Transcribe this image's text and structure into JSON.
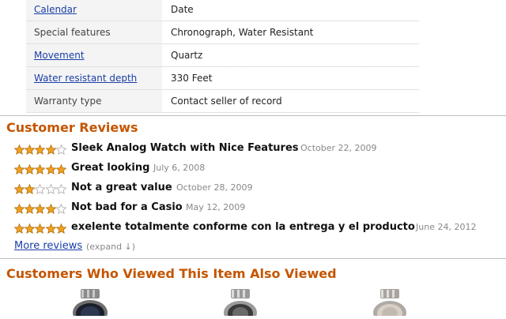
{
  "specs": [
    {
      "label": "Calendar",
      "value": "Date",
      "link": true
    },
    {
      "label": "Special features",
      "value": "Chronograph, Water Resistant",
      "link": false
    },
    {
      "label": "Movement",
      "value": "Quartz",
      "link": true
    },
    {
      "label": "Water resistant depth",
      "value": "330 Feet",
      "link": true
    },
    {
      "label": "Warranty type",
      "value": "Contact seller of record",
      "link": false
    }
  ],
  "reviews_section": {
    "title": "Customer Reviews",
    "reviews": [
      {
        "rating": 4,
        "title": "Sleek Analog Watch with Nice Features",
        "date": "October 22, 2009"
      },
      {
        "rating": 5,
        "title": "Great looking",
        "date": "July 6, 2008"
      },
      {
        "rating": 2,
        "title": "Not a great value",
        "date": "October 28, 2009"
      },
      {
        "rating": 4,
        "title": "Not bad for a Casio",
        "date": "May 12, 2009"
      },
      {
        "rating": 5,
        "title": "exelente totalmente conforme con la entrega y el producto",
        "date": "June 24, 2012"
      }
    ],
    "more_label": "More reviews",
    "expand_label": "(expand ↓)"
  },
  "also_viewed": {
    "title": "Customers Who Viewed This Item Also Viewed",
    "items": [
      {
        "icon": "watch-thumbnail-black-dial"
      },
      {
        "icon": "watch-thumbnail-silver-dial"
      },
      {
        "icon": "watch-thumbnail-silver-dial"
      }
    ]
  },
  "colors": {
    "section_title": "#c45500",
    "link": "#1a3ea6",
    "star_filled": "#f0a020",
    "star_empty": "#ffffff",
    "date": "#888888"
  }
}
